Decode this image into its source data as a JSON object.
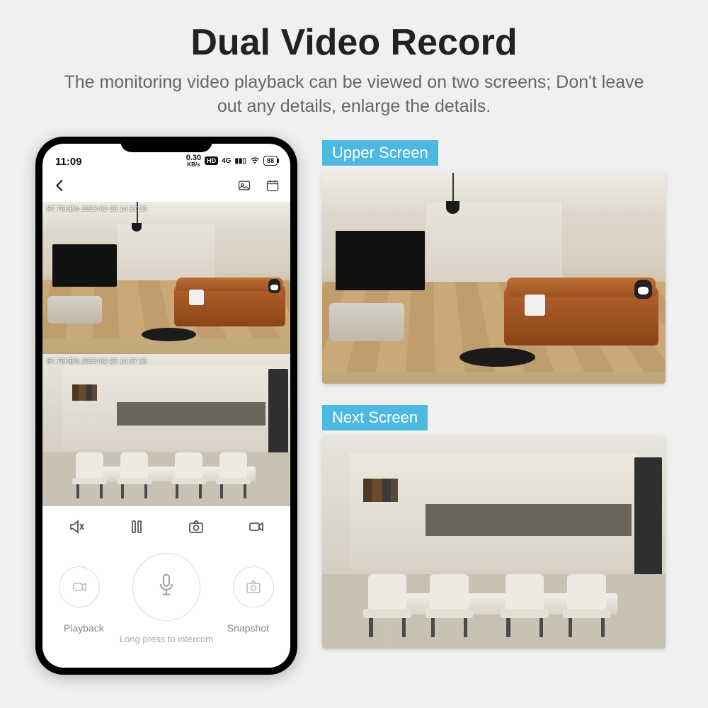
{
  "header": {
    "title": "Dual Video Record",
    "subtitle": "The monitoring video playback can be viewed on two screens; Don't leave out any details, enlarge the details."
  },
  "phone": {
    "status": {
      "time": "11:09",
      "kbps_value": "0.30",
      "kbps_unit": "KB/s",
      "hd": "HD",
      "network": "4G",
      "battery": "88"
    },
    "feeds": {
      "upper_overlay": "87.76KB/s 2023-02-25 14:37:15",
      "lower_overlay": "87.76KB/s 2023-02-25 14:37:15"
    },
    "bottom": {
      "playback": "Playback",
      "snapshot": "Snapshot",
      "intercom": "Long press to intercom"
    }
  },
  "callouts": {
    "upper": "Upper Screen",
    "next": "Next Screen"
  },
  "icons": {
    "back": "back-chevron-icon",
    "gallery": "gallery-icon",
    "calendar": "calendar-icon",
    "mute": "mute-icon",
    "pause": "pause-icon",
    "camera": "camera-icon",
    "record": "record-icon",
    "playback_small": "playback-icon",
    "mic": "microphone-icon",
    "snapshot_small": "snapshot-icon",
    "wifi": "wifi-icon",
    "signal": "signal-icon",
    "battery": "battery-icon"
  },
  "colors": {
    "callout_bg": "#4db8e0",
    "page_bg": "#f0f0f0"
  }
}
